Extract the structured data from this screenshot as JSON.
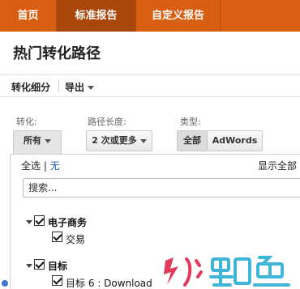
{
  "nav": {
    "tabs": [
      "首页",
      "标准报告",
      "自定义报告"
    ],
    "active": "标准报告",
    "color": "#d85f12",
    "active_color": "#a9470b"
  },
  "page": {
    "title": "热门转化路径"
  },
  "subbar": {
    "breakdown_label": "转化细分",
    "export_label": "导出"
  },
  "filters": {
    "conversion": {
      "label": "转化:",
      "value": "所有"
    },
    "path_length": {
      "label": "路径长度:",
      "value": "2 次或更多"
    },
    "type": {
      "label": "类型:",
      "options": [
        "全部",
        "AdWords"
      ],
      "selected": "全部"
    }
  },
  "dropdown": {
    "select_all": "全选",
    "separator": "|",
    "select_none": "无",
    "show_all": "显示全部",
    "search_placeholder": "搜索...",
    "groups": [
      {
        "label": "电子商务",
        "checked": true,
        "expanded": true,
        "children": [
          {
            "label": "交易",
            "checked": true
          }
        ]
      },
      {
        "label": "目标",
        "checked": true,
        "expanded": true,
        "children": [
          {
            "label": "目标 6 : Download",
            "checked": true
          }
        ]
      }
    ]
  },
  "watermark": {
    "text": "火鲤鱼",
    "icons": [
      "lightning-icon",
      "fish-icon"
    ]
  }
}
